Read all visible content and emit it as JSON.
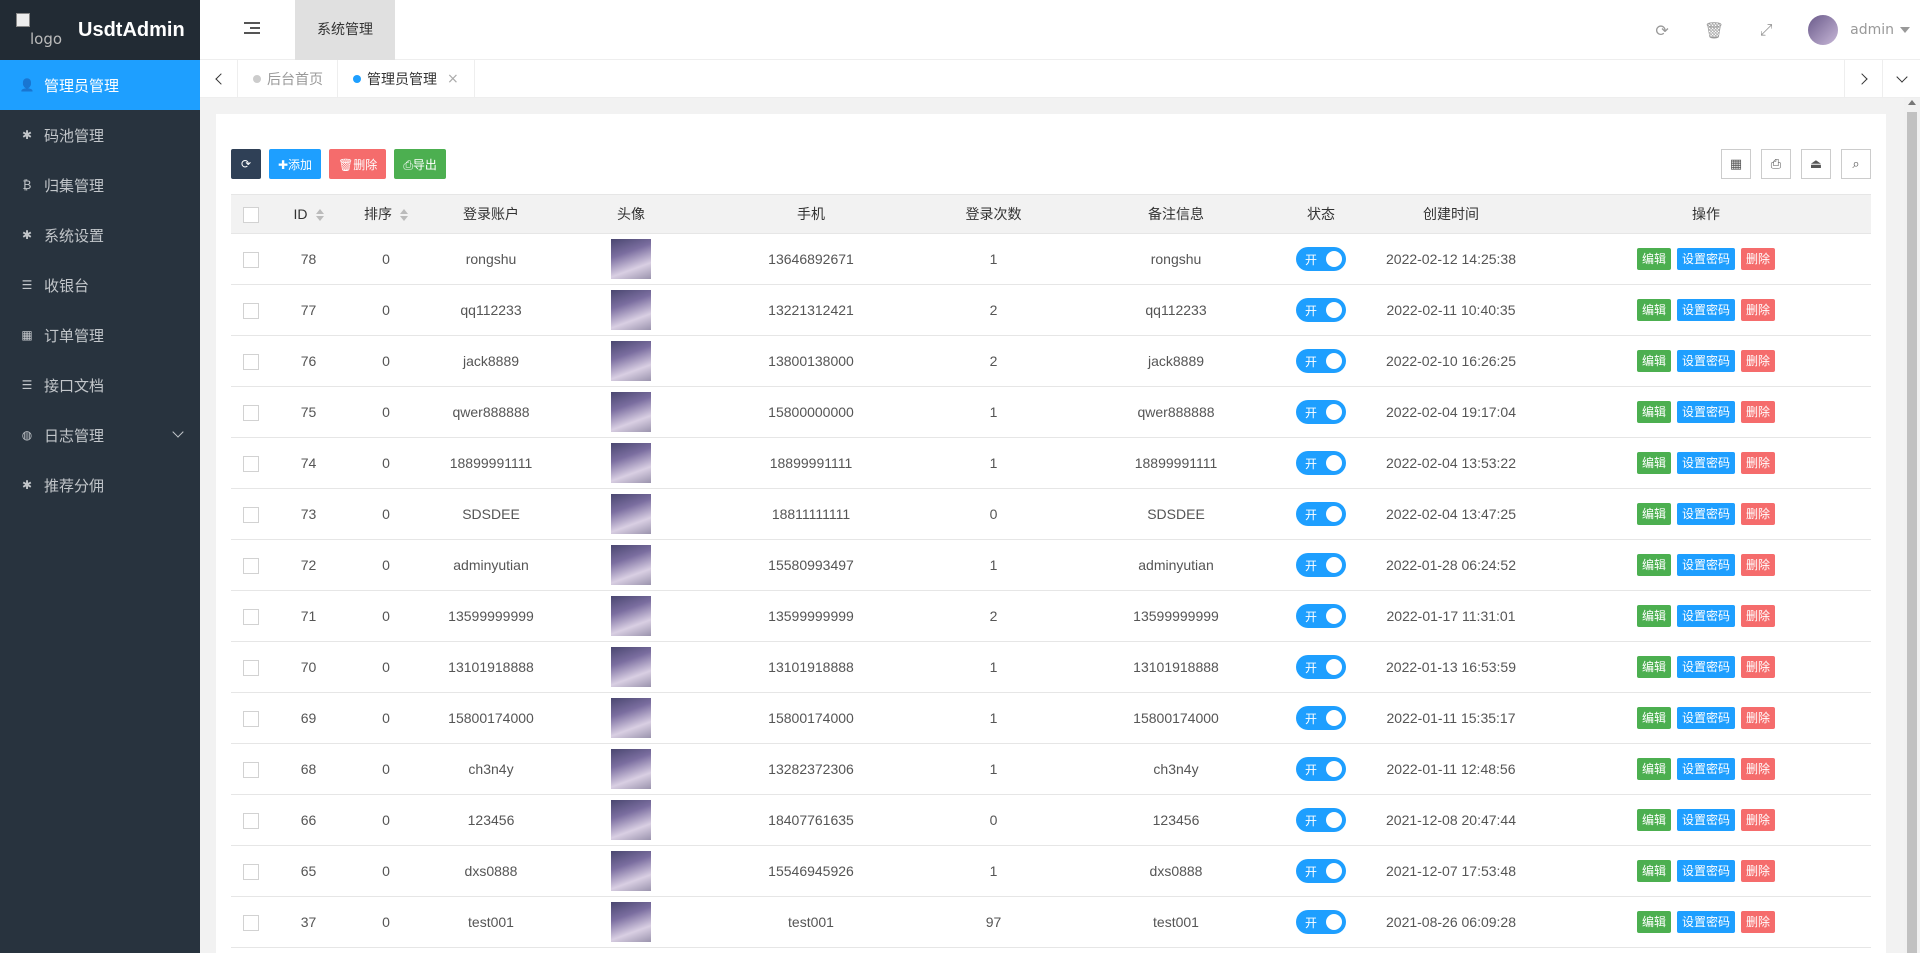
{
  "app": {
    "logo_alt": "logo",
    "title": "UsdtAdmin"
  },
  "sidebar": {
    "items": [
      {
        "label": "管理员管理",
        "icon": "user-icon",
        "glyph": "👤",
        "active": true
      },
      {
        "label": "码池管理",
        "icon": "android-icon",
        "glyph": "✱"
      },
      {
        "label": "归集管理",
        "icon": "bitcoin-icon",
        "glyph": "₿"
      },
      {
        "label": "系统设置",
        "icon": "asterisk-icon",
        "glyph": "✱"
      },
      {
        "label": "收银台",
        "icon": "list-icon",
        "glyph": "☰"
      },
      {
        "label": "订单管理",
        "icon": "calculator-icon",
        "glyph": "▦"
      },
      {
        "label": "接口文档",
        "icon": "align-left-icon",
        "glyph": "☰"
      },
      {
        "label": "日志管理",
        "icon": "log-icon",
        "glyph": "◍",
        "expandable": true
      },
      {
        "label": "推荐分佣",
        "icon": "android-icon",
        "glyph": "✱"
      }
    ]
  },
  "header": {
    "top_tab": "系统管理",
    "user": "admin"
  },
  "tabs": {
    "home": "后台首页",
    "current": "管理员管理",
    "close": "×"
  },
  "toolbar": {
    "refresh_glyph": "⟳",
    "add": "✚添加",
    "delete": "🗑删除",
    "export": "⎙导出"
  },
  "table": {
    "headers": [
      "ID",
      "排序",
      "登录账户",
      "头像",
      "手机",
      "登录次数",
      "备注信息",
      "状态",
      "创建时间",
      "操作"
    ],
    "status_label": "开",
    "ops": {
      "edit": "编辑",
      "password": "设置密码",
      "delete": "删除"
    },
    "rows": [
      {
        "id": "78",
        "sort": "0",
        "account": "rongshu",
        "phone": "13646892671",
        "logins": "1",
        "note": "rongshu",
        "created": "2022-02-12 14:25:38"
      },
      {
        "id": "77",
        "sort": "0",
        "account": "qq112233",
        "phone": "13221312421",
        "logins": "2",
        "note": "qq112233",
        "created": "2022-02-11 10:40:35"
      },
      {
        "id": "76",
        "sort": "0",
        "account": "jack8889",
        "phone": "13800138000",
        "logins": "2",
        "note": "jack8889",
        "created": "2022-02-10 16:26:25"
      },
      {
        "id": "75",
        "sort": "0",
        "account": "qwer888888",
        "phone": "15800000000",
        "logins": "1",
        "note": "qwer888888",
        "created": "2022-02-04 19:17:04"
      },
      {
        "id": "74",
        "sort": "0",
        "account": "18899991111",
        "phone": "18899991111",
        "logins": "1",
        "note": "18899991111",
        "created": "2022-02-04 13:53:22"
      },
      {
        "id": "73",
        "sort": "0",
        "account": "SDSDEE",
        "phone": "18811111111",
        "logins": "0",
        "note": "SDSDEE",
        "created": "2022-02-04 13:47:25"
      },
      {
        "id": "72",
        "sort": "0",
        "account": "adminyutian",
        "phone": "15580993497",
        "logins": "1",
        "note": "adminyutian",
        "created": "2022-01-28 06:24:52"
      },
      {
        "id": "71",
        "sort": "0",
        "account": "13599999999",
        "phone": "13599999999",
        "logins": "2",
        "note": "13599999999",
        "created": "2022-01-17 11:31:01"
      },
      {
        "id": "70",
        "sort": "0",
        "account": "13101918888",
        "phone": "13101918888",
        "logins": "1",
        "note": "13101918888",
        "created": "2022-01-13 16:53:59"
      },
      {
        "id": "69",
        "sort": "0",
        "account": "15800174000",
        "phone": "15800174000",
        "logins": "1",
        "note": "15800174000",
        "created": "2022-01-11 15:35:17"
      },
      {
        "id": "68",
        "sort": "0",
        "account": "ch3n4y",
        "phone": "13282372306",
        "logins": "1",
        "note": "ch3n4y",
        "created": "2022-01-11 12:48:56"
      },
      {
        "id": "66",
        "sort": "0",
        "account": "123456",
        "phone": "18407761635",
        "logins": "0",
        "note": "123456",
        "created": "2021-12-08 20:47:44"
      },
      {
        "id": "65",
        "sort": "0",
        "account": "dxs0888",
        "phone": "15546945926",
        "logins": "1",
        "note": "dxs0888",
        "created": "2021-12-07 17:53:48"
      },
      {
        "id": "37",
        "sort": "0",
        "account": "test001",
        "phone": "test001",
        "logins": "97",
        "note": "test001",
        "created": "2021-08-26 06:09:28"
      }
    ]
  },
  "colors": {
    "sidebar_bg": "#28333e",
    "active": "#1e9fff",
    "edit": "#4caf50",
    "delete": "#f56c6c"
  }
}
